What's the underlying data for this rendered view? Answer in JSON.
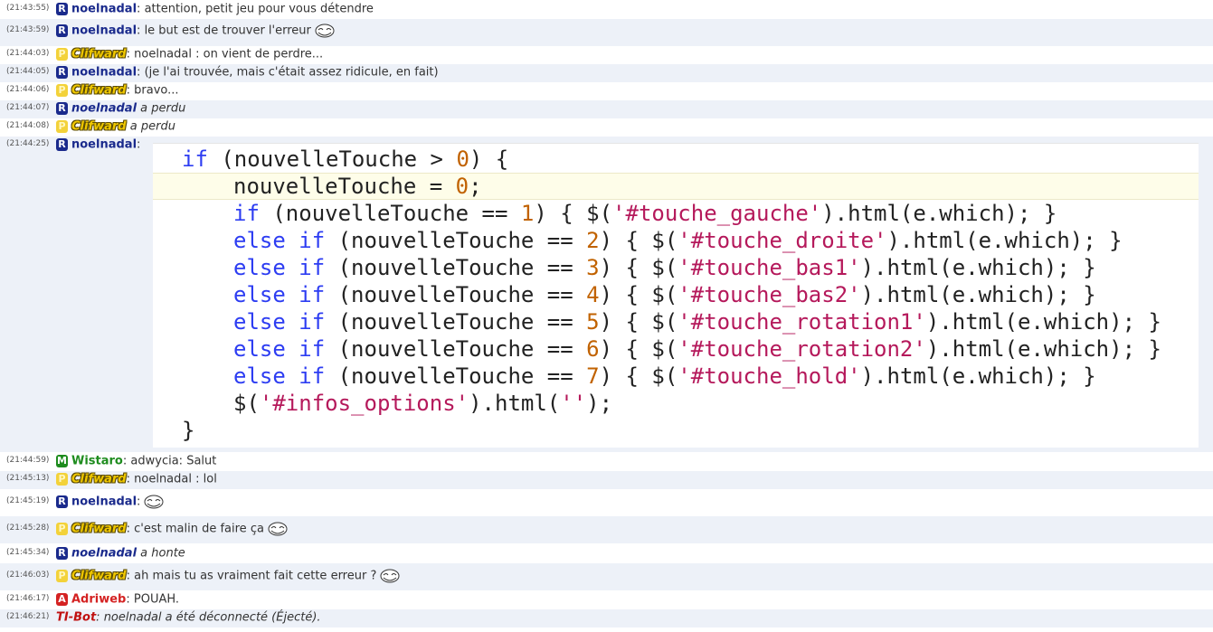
{
  "chat": {
    "rows": [
      {
        "time": "(21:43:55)",
        "rank": "R",
        "nick": "noelnadal",
        "sep": ":",
        "text": "attention, petit jeu pour vous détendre"
      },
      {
        "time": "(21:43:59)",
        "rank": "R",
        "nick": "noelnadal",
        "sep": ":",
        "text": "le but est de trouver l'erreur"
      },
      {
        "time": "(21:44:03)",
        "rank": "P",
        "nick": "Clifward",
        "sep": ":",
        "text": "noelnadal : on vient de perdre..."
      },
      {
        "time": "(21:44:05)",
        "rank": "R",
        "nick": "noelnadal",
        "sep": ":",
        "text": "(je l'ai trouvée, mais c'était assez ridicule, en fait)"
      },
      {
        "time": "(21:44:06)",
        "rank": "P",
        "nick": "Clifward",
        "sep": ":",
        "text": "bravo..."
      },
      {
        "time": "(21:44:07)",
        "rank": "R",
        "nick": "noelnadal",
        "sep": "",
        "text": "a perdu"
      },
      {
        "time": "(21:44:08)",
        "rank": "P",
        "nick": "Clifward",
        "sep": "",
        "text": "a perdu"
      },
      {
        "time": "(21:44:25)",
        "rank": "R",
        "nick": "noelnadal",
        "sep": ":",
        "text": ""
      },
      {
        "time": "(21:44:59)",
        "rank": "M",
        "nick": "Wistaro",
        "sep": ":",
        "text": "adwycia: Salut"
      },
      {
        "time": "(21:45:13)",
        "rank": "P",
        "nick": "Clifward",
        "sep": ":",
        "text": "noelnadal : lol"
      },
      {
        "time": "(21:45:19)",
        "rank": "R",
        "nick": "noelnadal",
        "sep": ":",
        "text": ""
      },
      {
        "time": "(21:45:28)",
        "rank": "P",
        "nick": "Clifward",
        "sep": ":",
        "text": "c'est malin de faire ça"
      },
      {
        "time": "(21:45:34)",
        "rank": "R",
        "nick": "noelnadal",
        "sep": "",
        "text": "a honte"
      },
      {
        "time": "(21:46:03)",
        "rank": "P",
        "nick": "Clifward",
        "sep": ":",
        "text": "ah mais tu as vraiment fait cette erreur ?"
      },
      {
        "time": "(21:46:17)",
        "rank": "A",
        "nick": "Adriweb",
        "sep": ":",
        "text": "POUAH."
      },
      {
        "time": "(21:46:21)",
        "rank": "",
        "nick": "TI-Bot",
        "sep": ":",
        "text": "noelnadal a été déconnecté (Éjecté)."
      }
    ]
  },
  "code": {
    "l1": {
      "kw": "if",
      "a": " (nouvelleTouche > ",
      "n": "0",
      "b": ") {"
    },
    "l2": {
      "a": "nouvelleTouche = ",
      "n": "0",
      "b": ";"
    },
    "l3": {
      "kw": "if",
      "a": " (nouvelleTouche == ",
      "n": "1",
      "b": ") { $(",
      "s": "'#touche_gauche'",
      "c": ").html(e.which); }"
    },
    "l4": {
      "kw": "else if",
      "a": " (nouvelleTouche == ",
      "n": "2",
      "b": ") { $(",
      "s": "'#touche_droite'",
      "c": ").html(e.which); }"
    },
    "l5": {
      "kw": "else if",
      "a": " (nouvelleTouche == ",
      "n": "3",
      "b": ") { $(",
      "s": "'#touche_bas1'",
      "c": ").html(e.which); }"
    },
    "l6": {
      "kw": "else if",
      "a": " (nouvelleTouche == ",
      "n": "4",
      "b": ") { $(",
      "s": "'#touche_bas2'",
      "c": ").html(e.which); }"
    },
    "l7": {
      "kw": "else if",
      "a": " (nouvelleTouche == ",
      "n": "5",
      "b": ") { $(",
      "s": "'#touche_rotation1'",
      "c": ").html(e.which); }"
    },
    "l8": {
      "kw": "else if",
      "a": " (nouvelleTouche == ",
      "n": "6",
      "b": ") { $(",
      "s": "'#touche_rotation2'",
      "c": ").html(e.which); }"
    },
    "l9": {
      "kw": "else if",
      "a": " (nouvelleTouche == ",
      "n": "7",
      "b": ") { $(",
      "s": "'#touche_hold'",
      "c": ").html(e.which); }"
    },
    "l10": {
      "a": "$(",
      "s": "'#infos_options'",
      "b": ").html(",
      "s2": "''",
      "c": ");"
    },
    "l11": {
      "a": "}"
    }
  },
  "colors": {
    "rank_R": "#1a2a8c",
    "rank_P": "#f3d23a",
    "rank_M": "#1e8c1e",
    "rank_A": "#d42222",
    "row_alt": "#edf1f8"
  },
  "icons": {
    "emoticon": "trollface-icon"
  }
}
